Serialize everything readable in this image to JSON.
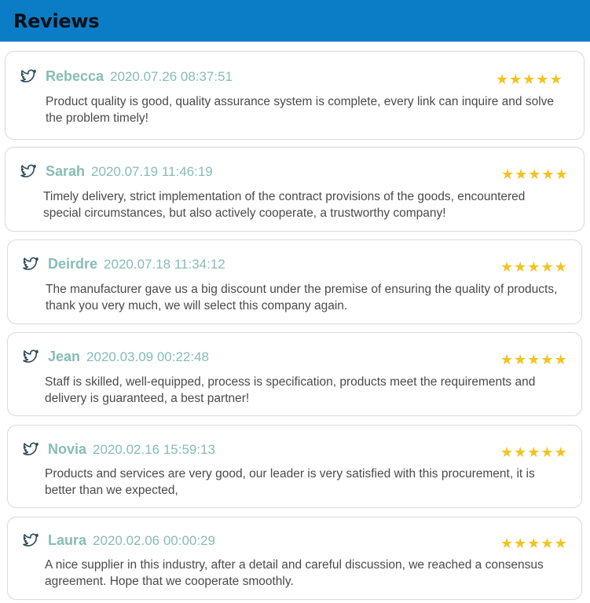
{
  "header": {
    "title": "Reviews"
  },
  "colors": {
    "header_bg": "#0a7dc6",
    "name_color": "#86bdb5",
    "star_color": "#f3c31f"
  },
  "reviews": [
    {
      "name": "Rebecca",
      "date": "2020.07.26 08:37:51",
      "rating": 5,
      "icon": "twitter-bird-icon",
      "text": "Product quality is good, quality assurance system is complete, every link can inquire and solve the problem timely!"
    },
    {
      "name": "Sarah",
      "date": "2020.07.19 11:46:19",
      "rating": 5,
      "icon": "twitter-bird-icon",
      "text": "Timely delivery, strict implementation of the contract provisions of the goods, encountered special circumstances, but also actively cooperate, a trustworthy company!"
    },
    {
      "name": "Deirdre",
      "date": "2020.07.18 11:34:12",
      "rating": 5,
      "icon": "twitter-bird-icon",
      "text": "The manufacturer gave us a big discount under the premise of ensuring the quality of products, thank you very much, we will select this company again."
    },
    {
      "name": "Jean",
      "date": "2020.03.09 00:22:48",
      "rating": 5,
      "icon": "twitter-bird-icon",
      "text": "Staff is skilled, well-equipped, process is specification, products meet the requirements and delivery is guaranteed, a best partner!"
    },
    {
      "name": "Novia",
      "date": "2020.02.16 15:59:13",
      "rating": 5,
      "icon": "twitter-bird-icon",
      "text": "Products and services are very good, our leader is very satisfied with this procurement, it is better than we expected,"
    },
    {
      "name": "Laura",
      "date": "2020.02.06 00:00:29",
      "rating": 5,
      "icon": "twitter-bird-icon",
      "text": "A nice supplier in this industry, after a detail and careful discussion, we reached a consensus agreement. Hope that we cooperate smoothly."
    }
  ]
}
